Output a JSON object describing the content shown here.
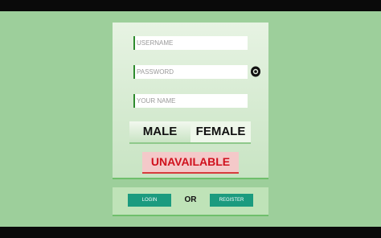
{
  "form": {
    "username_placeholder": "USERNAME",
    "password_placeholder": "PASSWORD",
    "name_placeholder": "YOUR NAME",
    "password_toggle_icon": "eye-icon"
  },
  "gender": {
    "male_label": "MALE",
    "female_label": "FEMALE"
  },
  "status": {
    "text": "UNAVAILABLE"
  },
  "actions": {
    "login_label": "LOGIN",
    "or_label": "OR",
    "register_label": "REGISTER"
  },
  "colors": {
    "background": "#9dcf9b",
    "accent": "#1b9b7f",
    "status_red": "#d0101c"
  }
}
